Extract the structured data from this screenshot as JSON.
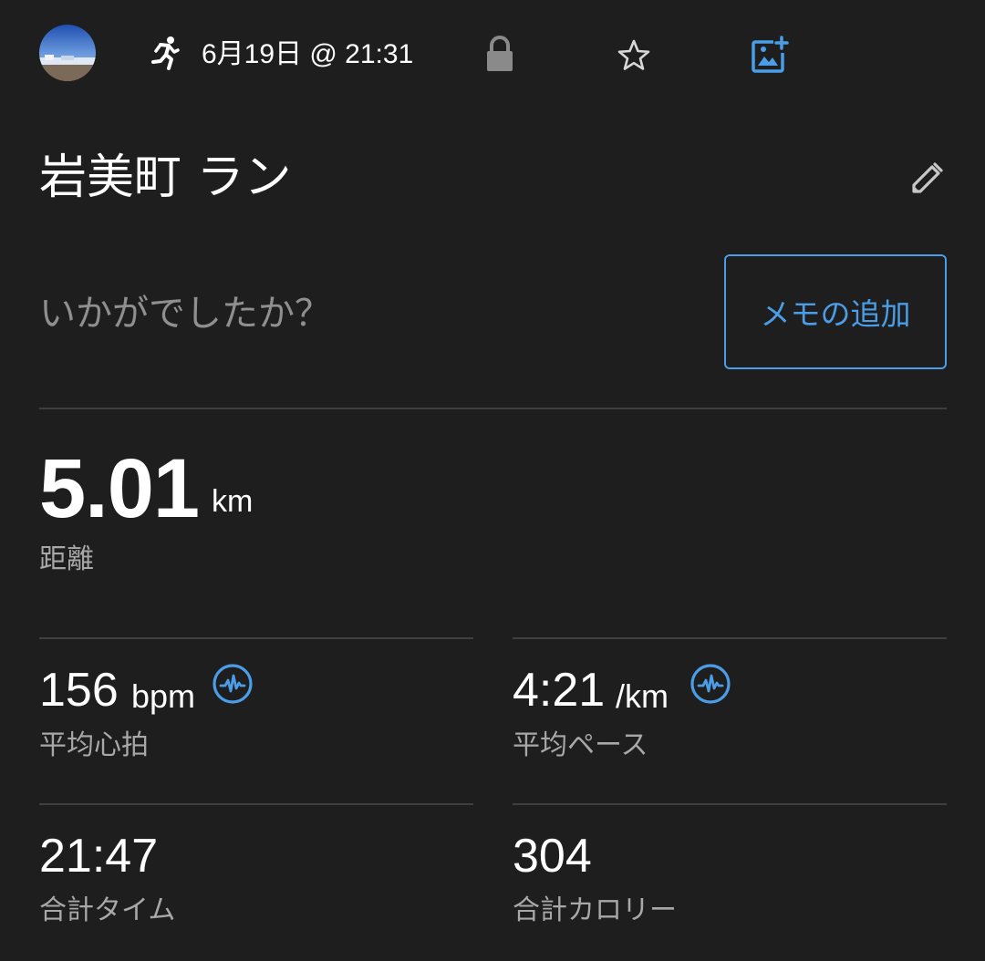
{
  "header": {
    "avatar_icon": "profile-photo-avatar",
    "activity_icon": "running-icon",
    "datetime": "6月19日 @ 21:31",
    "privacy_icon": "lock-icon",
    "favorite_icon": "star-icon",
    "add_photo_icon": "add-photo-icon"
  },
  "activity": {
    "title": "岩美町 ラン",
    "edit_icon": "pencil-icon",
    "prompt": "いかがでしたか？",
    "memo_button": "メモの追加"
  },
  "distance": {
    "value": "5.01",
    "unit": "km",
    "label": "距離"
  },
  "stats": {
    "heart_rate": {
      "value": "156",
      "unit": "bpm",
      "label": "平均心拍",
      "icon": "heart-rate-icon"
    },
    "pace": {
      "value": "4:21",
      "unit": "/km",
      "label": "平均ペース",
      "icon": "heart-rate-icon"
    },
    "time": {
      "value": "21:47",
      "label": "合計タイム"
    },
    "calories": {
      "value": "304",
      "label": "合計カロリー"
    }
  },
  "colors": {
    "background": "#1e1e1e",
    "accent": "#4a9de6",
    "divider": "#3f3f3f",
    "muted_text": "#a8a8a8"
  }
}
